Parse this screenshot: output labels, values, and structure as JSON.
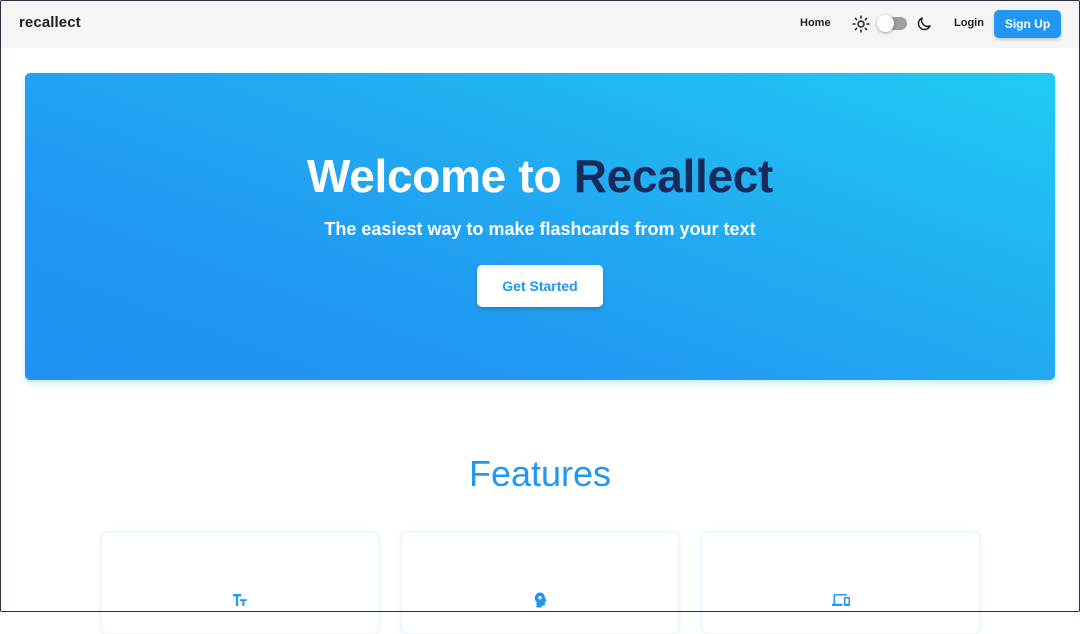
{
  "navbar": {
    "brand": "recallect",
    "home_label": "Home",
    "login_label": "Login",
    "signup_label": "Sign Up",
    "theme_toggle": {
      "icon_left": "sun-icon",
      "icon_right": "moon-icon",
      "dark_mode": false
    }
  },
  "hero": {
    "title_prefix": "Welcome to ",
    "title_accent": "Recallect",
    "subtitle": "The easiest way to make flashcards from your text",
    "cta_label": "Get Started"
  },
  "features": {
    "heading": "Features",
    "cards": [
      {
        "icon": "text-fields-icon"
      },
      {
        "icon": "brain-head-icon"
      },
      {
        "icon": "devices-icon"
      }
    ]
  },
  "colors": {
    "primary": "#2196f3",
    "hero_gradient_start": "#2196f3",
    "hero_gradient_end": "#20cbf3",
    "accent_text": "#172a5a",
    "navbar_bg": "#f5f5f5"
  }
}
